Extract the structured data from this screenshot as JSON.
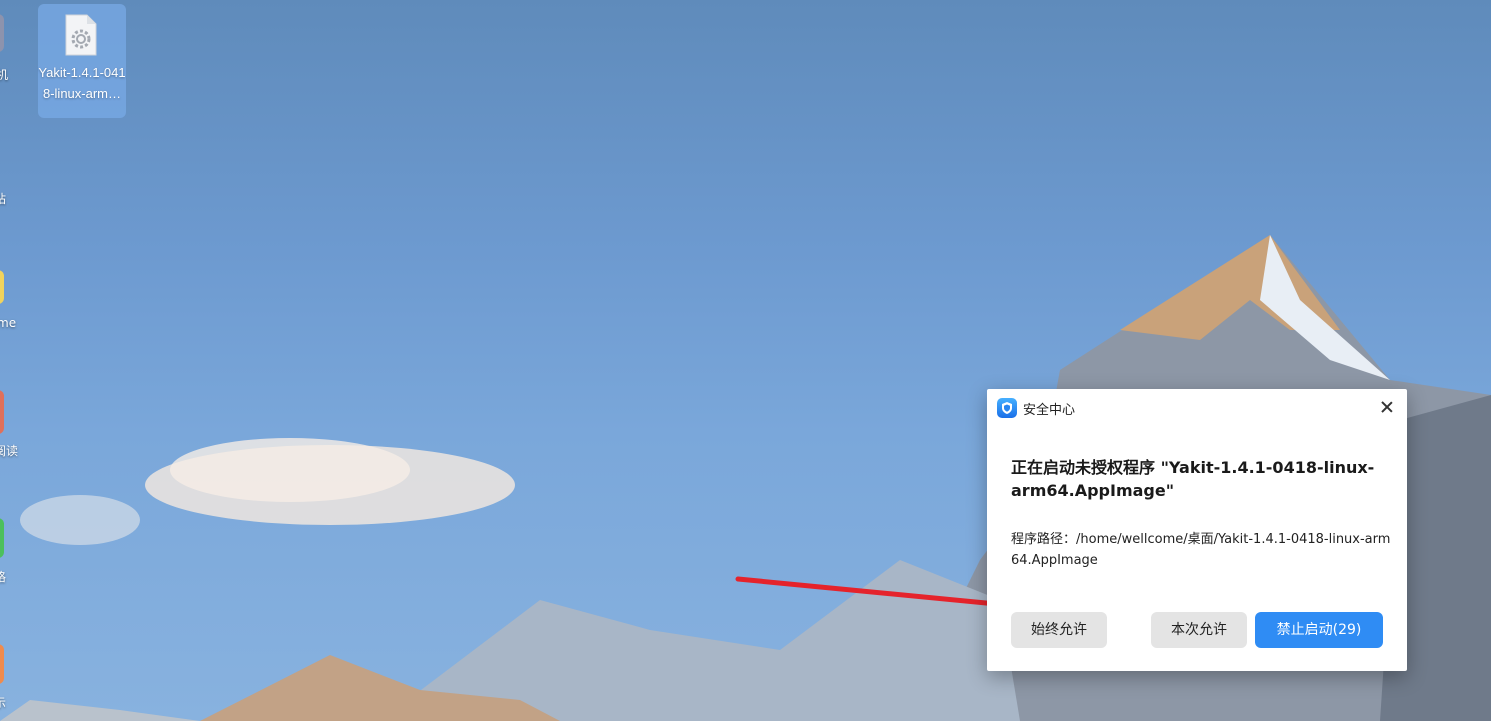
{
  "desktop": {
    "left_icons": [
      {
        "label": "机",
        "color": "#8d93ad"
      },
      {
        "label": "站",
        "color": "#7f99c2"
      },
      {
        "label": "me",
        "color": "#f1d35c"
      },
      {
        "label": "阅读",
        "color": "#e0705a"
      },
      {
        "label": "格",
        "color": "#4cc05c"
      },
      {
        "label": "示",
        "color": "#f08b4d"
      }
    ],
    "selected_file": {
      "name_line1": "Yakit-1.4.1-041",
      "name_line2": "8-linux-arm…",
      "icon": "settings-file-icon"
    }
  },
  "dialog": {
    "app_icon": "shield-icon",
    "title": "安全中心",
    "close_icon": "close-icon",
    "heading": "正在启动未授权程序 \"Yakit-1.4.1-0418-linux-arm64.AppImage\"",
    "path_label": "程序路径：",
    "path_value": "/home/wellcome/桌面/Yakit-1.4.1-0418-linux-arm64.AppImage",
    "buttons": {
      "always_allow": "始终允许",
      "allow_once": "本次允许",
      "deny": "禁止启动(29)"
    }
  },
  "colors": {
    "deny_button": "#2f8cf4",
    "secondary_button": "#e4e4e4",
    "arrow": "#e5232b"
  }
}
